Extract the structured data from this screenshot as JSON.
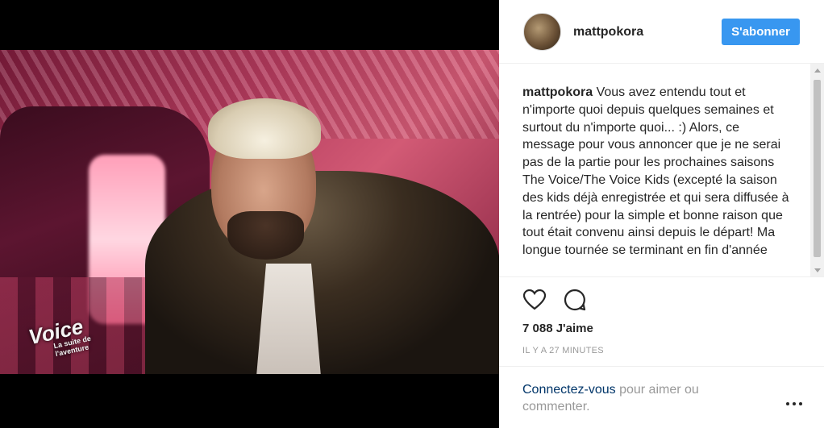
{
  "media": {
    "logo_text": "Voice",
    "logo_subtext": "La suite de l'aventure"
  },
  "header": {
    "username": "mattpokora",
    "follow_label": "S'abonner",
    "avatar_icon": "avatar-icon"
  },
  "caption": {
    "author": "mattpokora",
    "text": "Vous avez entendu tout et n'importe quoi depuis quelques semaines et surtout du n'importe quoi... :) Alors, ce message pour vous annoncer que je ne serai pas de la partie pour les prochaines saisons The Voice/The Voice Kids (excepté la saison des kids déjà enregistrée et qui sera diffusée à la rentrée) pour la simple et bonne raison que tout était convenu ainsi depuis le départ! Ma longue tournée se terminant en fin d'année"
  },
  "actions": {
    "like_icon": "heart-icon",
    "comment_icon": "comment-icon"
  },
  "likes": "7 088 J'aime",
  "timestamp": "IL Y A 27 MINUTES",
  "footer": {
    "login_link": "Connectez-vous",
    "login_rest": " pour aimer ou commenter.",
    "more_icon": "more-icon"
  },
  "colors": {
    "accent": "#3897f0",
    "link": "#003569",
    "muted": "#999999"
  }
}
